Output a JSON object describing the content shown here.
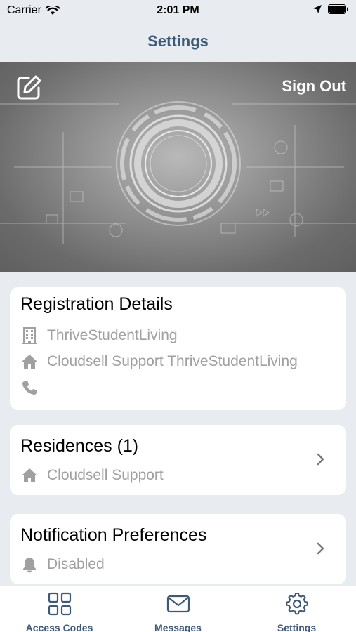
{
  "status_bar": {
    "carrier": "Carrier",
    "time": "2:01 PM"
  },
  "nav": {
    "title": "Settings"
  },
  "banner": {
    "sign_out_label": "Sign Out"
  },
  "registration": {
    "title": "Registration Details",
    "building": "ThriveStudentLiving",
    "home": "Cloudsell Support ThriveStudentLiving",
    "phone": ""
  },
  "residences": {
    "title": "Residences (1)",
    "item": "Cloudsell Support"
  },
  "notifications": {
    "title": "Notification Preferences",
    "status": "Disabled"
  },
  "tabs": [
    {
      "label": "Access Codes",
      "icon": "grid-icon"
    },
    {
      "label": "Messages",
      "icon": "envelope-icon"
    },
    {
      "label": "Settings",
      "icon": "gear-icon"
    }
  ],
  "colors": {
    "accent": "#3d5a78",
    "muted_text": "#a0a0a0",
    "background": "#e8ebef"
  }
}
